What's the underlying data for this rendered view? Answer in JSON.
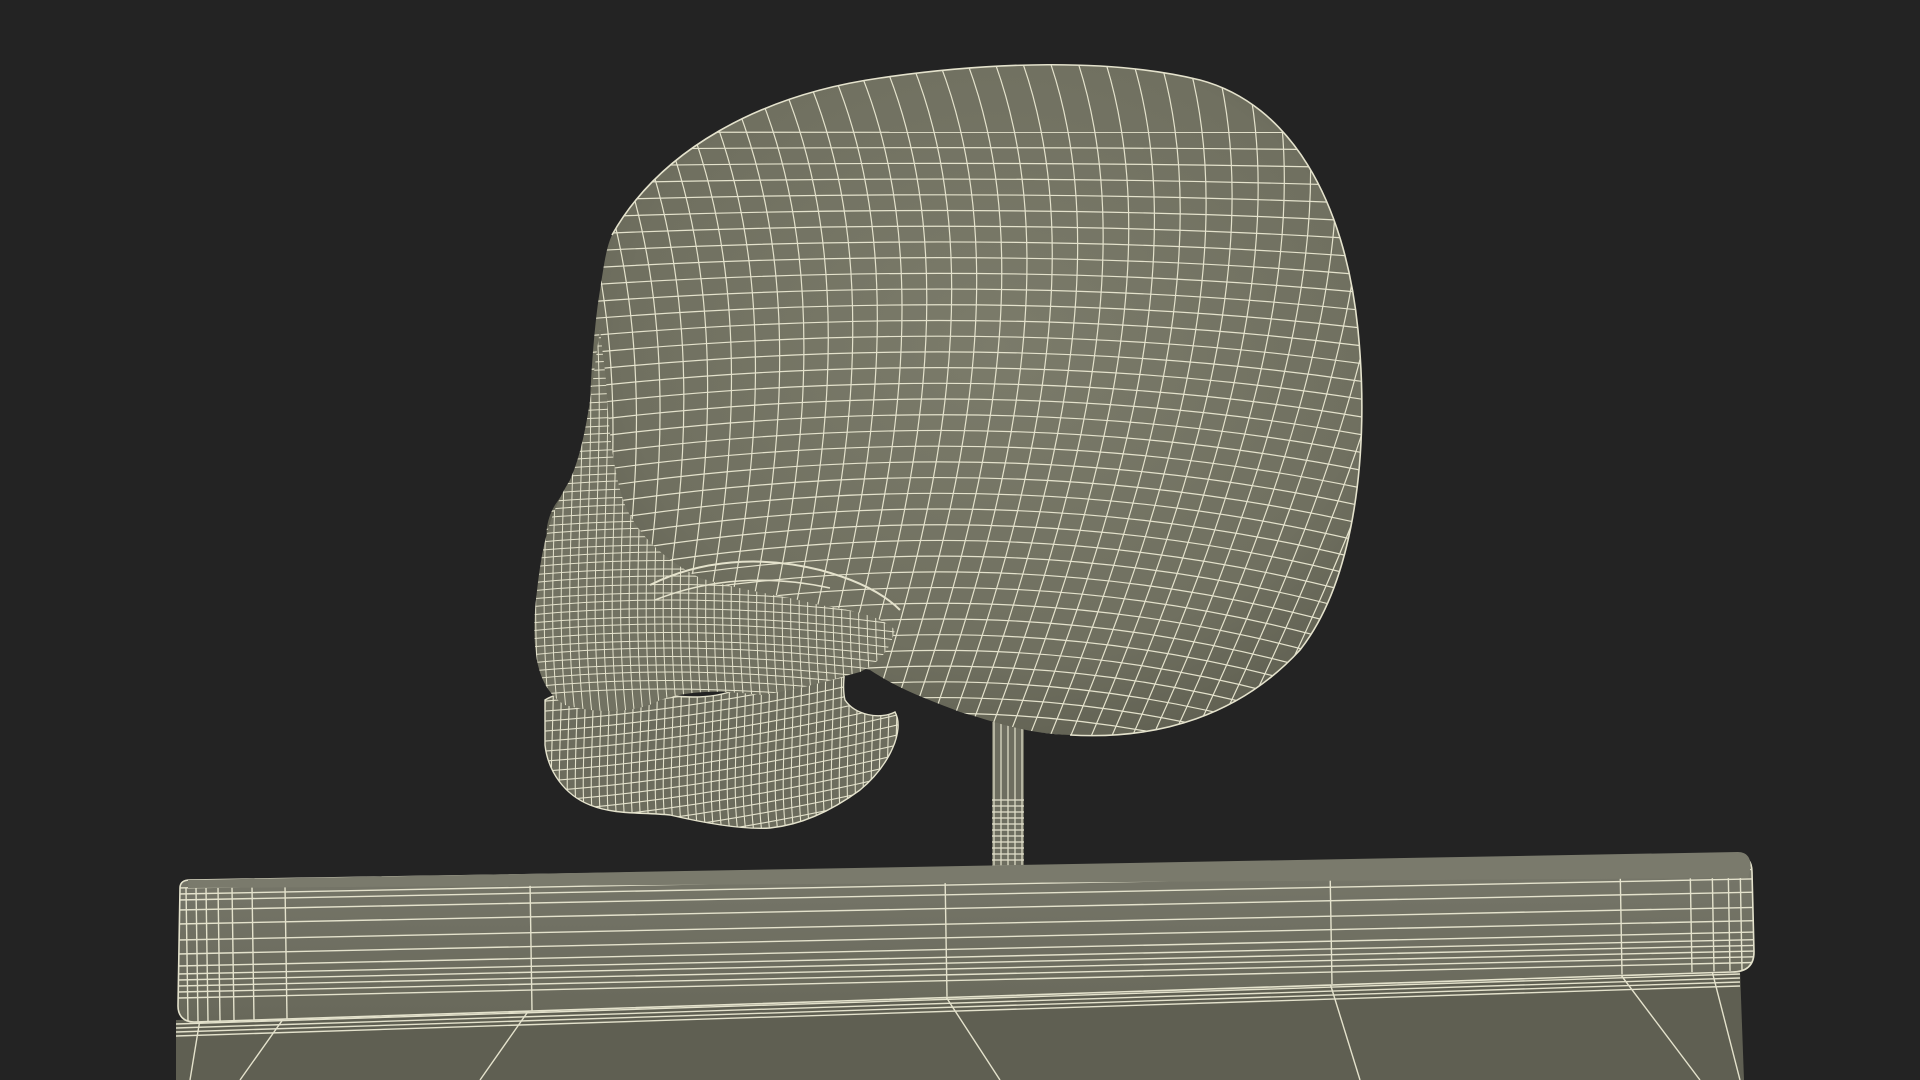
{
  "scene": {
    "subject": "skull-wireframe-on-stand",
    "render_mode": "wireframe-on-shaded",
    "colors": {
      "background": "#232323",
      "surface": "#707060",
      "surface_shadow": "#5e5e50",
      "surface_light": "#7b7b6a",
      "wire": "#e4e2cc"
    }
  }
}
